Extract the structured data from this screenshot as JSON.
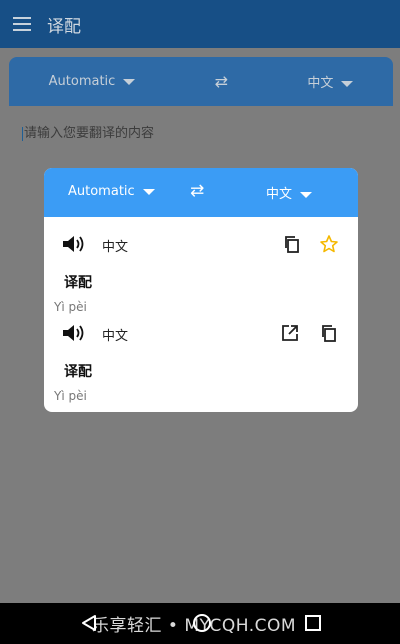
{
  "app": {
    "title": "译配"
  },
  "language_bar": {
    "source": "Automatic",
    "target": "中文"
  },
  "input": {
    "placeholder": "请输入您要翻译的内容"
  },
  "dialog": {
    "source": "Automatic",
    "target": "中文",
    "results": [
      {
        "lang": "中文",
        "term": "译配",
        "pinyin": "Yì pèi"
      },
      {
        "lang": "中文",
        "term": "译配",
        "pinyin": "Yì pèi"
      }
    ]
  },
  "watermark": "乐享轻汇 • MYCQH.COM",
  "colors": {
    "appbar": "#174f86",
    "dialog_header": "#3b9cf5",
    "star": "#f5b800"
  },
  "icons": [
    "menu-icon",
    "swap-icon",
    "speaker-icon",
    "copy-icon",
    "star-icon",
    "open-external-icon"
  ]
}
